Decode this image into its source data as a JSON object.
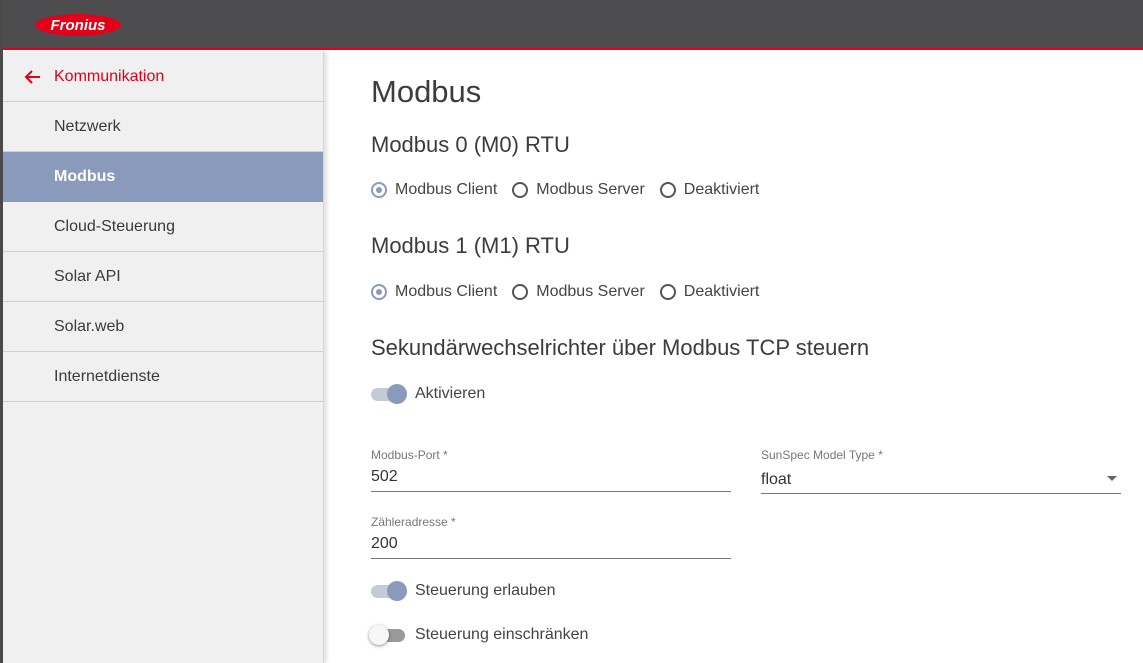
{
  "header": {
    "logo_text": "Fronius",
    "brand_color": "#e2001a",
    "bar_color": "#4d4d4f"
  },
  "sidebar": {
    "back_label": "Kommunikation",
    "items": [
      {
        "label": "Netzwerk",
        "active": false
      },
      {
        "label": "Modbus",
        "active": true
      },
      {
        "label": "Cloud-Steuerung",
        "active": false
      },
      {
        "label": "Solar API",
        "active": false
      },
      {
        "label": "Solar.web",
        "active": false
      },
      {
        "label": "Internetdienste",
        "active": false
      }
    ],
    "active_color": "#8a9aba"
  },
  "main": {
    "title": "Modbus",
    "m0": {
      "heading": "Modbus 0 (M0) RTU",
      "options": [
        "Modbus Client",
        "Modbus Server",
        "Deaktiviert"
      ],
      "selected": "Modbus Client"
    },
    "m1": {
      "heading": "Modbus 1 (M1) RTU",
      "options": [
        "Modbus Client",
        "Modbus Server",
        "Deaktiviert"
      ],
      "selected": "Modbus Client"
    },
    "tcp": {
      "heading": "Sekundärwechselrichter über Modbus TCP steuern",
      "activate_label": "Aktivieren",
      "activate_on": true,
      "port_label": "Modbus-Port *",
      "port_value": "502",
      "sunspec_label": "SunSpec Model Type *",
      "sunspec_value": "float",
      "meter_label": "Zähleradresse *",
      "meter_value": "200",
      "allow_label": "Steuerung erlauben",
      "allow_on": true,
      "restrict_label": "Steuerung einschränken",
      "restrict_on": false
    }
  }
}
